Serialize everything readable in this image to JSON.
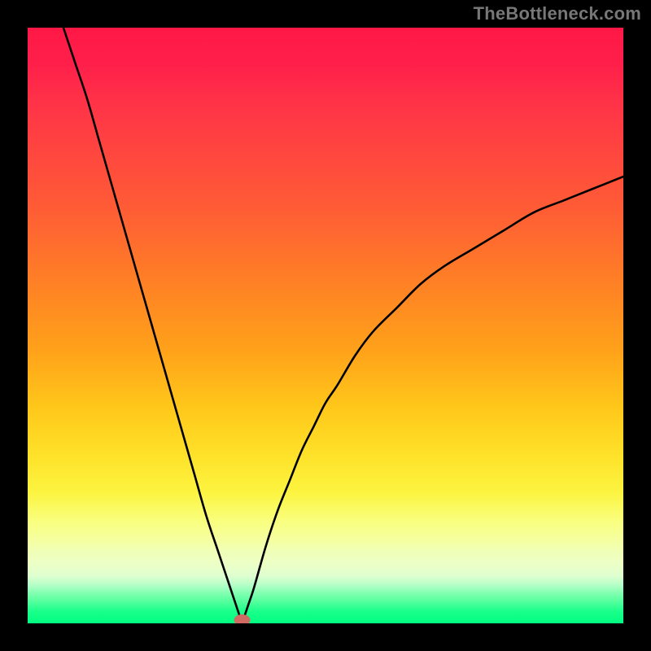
{
  "watermark": "TheBottleneck.com",
  "colors": {
    "gradient_top": "#ff1846",
    "gradient_mid": "#ffe22a",
    "gradient_bottom": "#00ff80",
    "curve": "#000000",
    "marker": "#cf6b63",
    "frame_bg": "#000000"
  },
  "chart_data": {
    "type": "line",
    "title": "",
    "xlabel": "",
    "ylabel": "",
    "xlim": [
      0,
      100
    ],
    "ylim": [
      0,
      100
    ],
    "minimum": {
      "x": 36,
      "y": 0
    },
    "series": [
      {
        "name": "left-branch",
        "x": [
          6,
          8,
          10,
          12,
          14,
          16,
          18,
          20,
          22,
          24,
          26,
          28,
          30,
          32,
          34,
          35,
          36
        ],
        "values": [
          100,
          94,
          88,
          81,
          74,
          67,
          60,
          53,
          46,
          39,
          32,
          25,
          18,
          12,
          6,
          3,
          0
        ]
      },
      {
        "name": "right-branch",
        "x": [
          36,
          37,
          38,
          40,
          42,
          44,
          46,
          48,
          50,
          52,
          55,
          58,
          62,
          66,
          70,
          75,
          80,
          85,
          90,
          95,
          100
        ],
        "values": [
          0,
          3,
          6,
          13,
          19,
          24,
          29,
          33,
          37,
          40,
          45,
          49,
          53,
          57,
          60,
          63,
          66,
          69,
          71,
          73,
          75
        ]
      }
    ]
  }
}
